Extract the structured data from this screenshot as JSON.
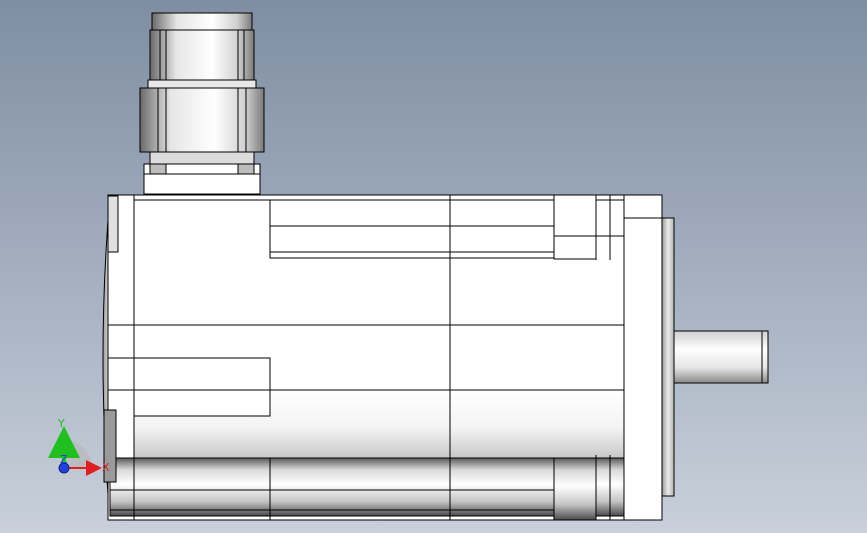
{
  "viewport": {
    "background_top": "#7f8ea3",
    "background_bottom": "#c9d0da"
  },
  "model": {
    "outline_color": "#000000",
    "face_color": "#ffffff",
    "shade_color": "#7a7a7a"
  },
  "triad": {
    "x_label": "X",
    "y_label": "Y",
    "z_label": "Z",
    "x_color": "#e02020",
    "y_color": "#20c020",
    "z_color": "#2040e0"
  }
}
